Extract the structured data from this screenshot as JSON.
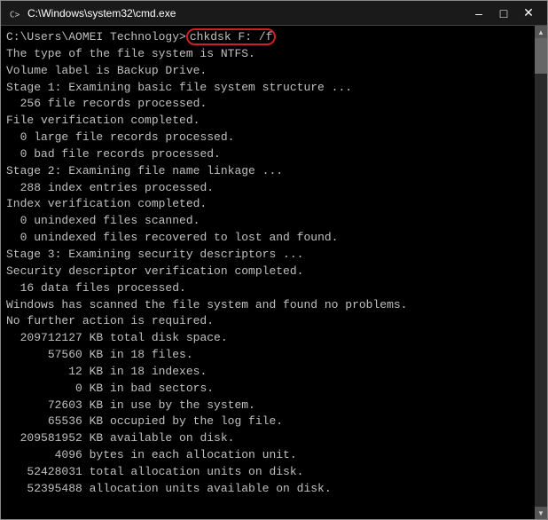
{
  "window": {
    "title": "C:\\Windows\\system32\\cmd.exe",
    "icon": "cmd-icon"
  },
  "controls": {
    "minimize": "–",
    "maximize": "□",
    "close": "✕"
  },
  "terminal": {
    "prompt": "C:\\Users\\AOMEI Technology>",
    "command": "chkdsk F: /f",
    "lines": [
      "The type of the file system is NTFS.",
      "Volume label is Backup Drive.",
      "",
      "Stage 1: Examining basic file system structure ...",
      "  256 file records processed.",
      "File verification completed.",
      "  0 large file records processed.",
      "  0 bad file records processed.",
      "",
      "Stage 2: Examining file name linkage ...",
      "  288 index entries processed.",
      "Index verification completed.",
      "  0 unindexed files scanned.",
      "  0 unindexed files recovered to lost and found.",
      "",
      "Stage 3: Examining security descriptors ...",
      "Security descriptor verification completed.",
      "  16 data files processed.",
      "",
      "Windows has scanned the file system and found no problems.",
      "No further action is required.",
      "",
      "  209712127 KB total disk space.",
      "      57560 KB in 18 files.",
      "         12 KB in 18 indexes.",
      "          0 KB in bad sectors.",
      "      72603 KB in use by the system.",
      "      65536 KB occupied by the log file.",
      "  209581952 KB available on disk.",
      "",
      "       4096 bytes in each allocation unit.",
      "   52428031 total allocation units on disk.",
      "   52395488 allocation units available on disk."
    ]
  }
}
